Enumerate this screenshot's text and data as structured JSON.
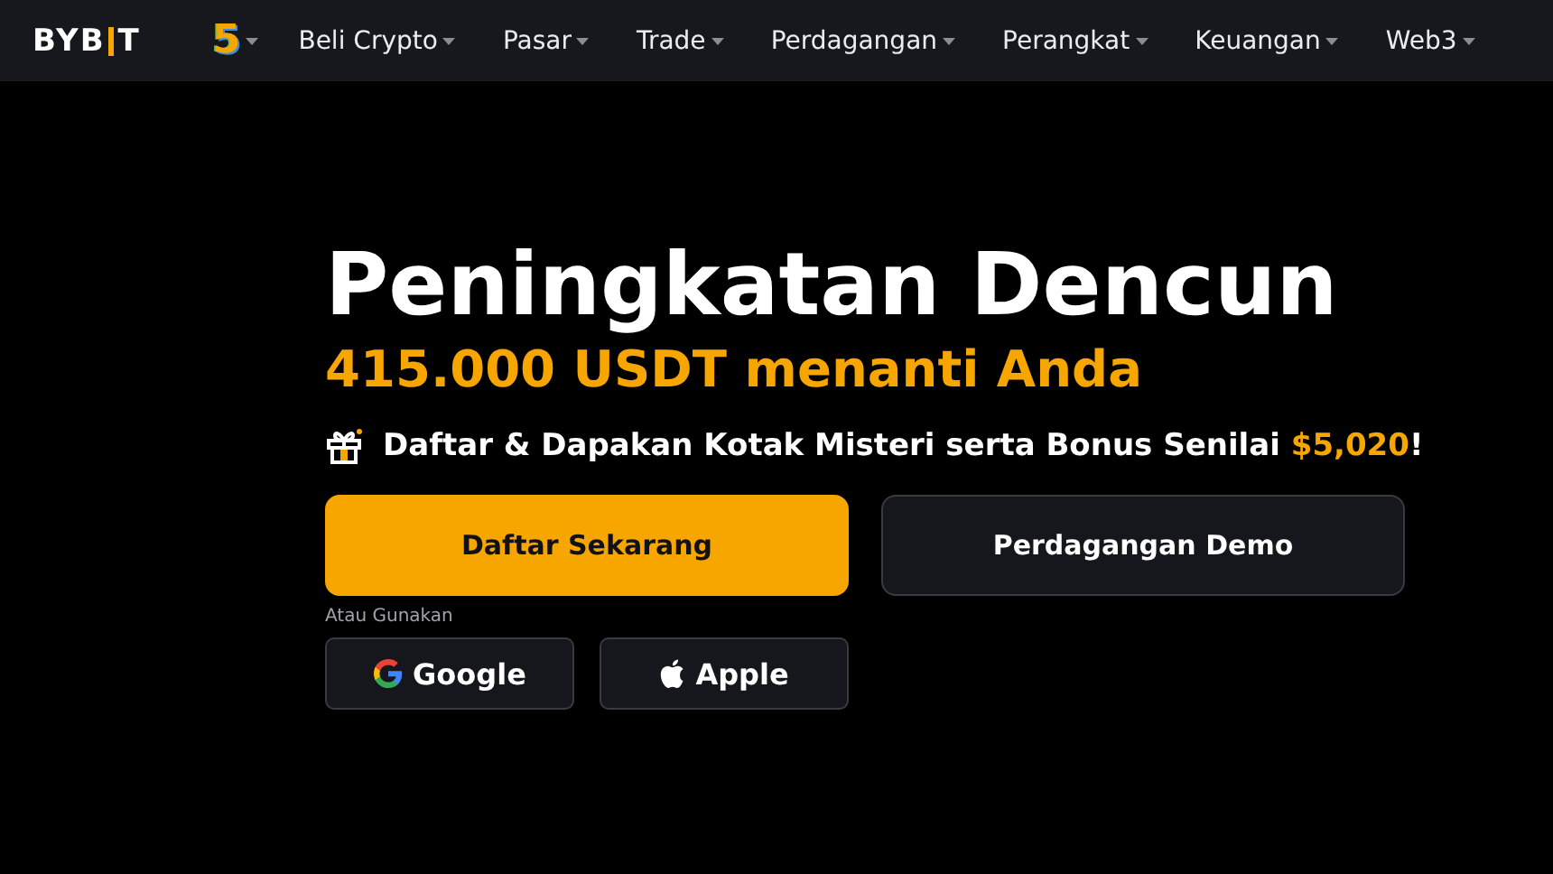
{
  "header": {
    "logo": {
      "left": "BYB",
      "right": "T"
    },
    "badge": "5",
    "nav": [
      {
        "label": "Beli Crypto"
      },
      {
        "label": "Pasar"
      },
      {
        "label": "Trade"
      },
      {
        "label": "Perdagangan"
      },
      {
        "label": "Perangkat"
      },
      {
        "label": "Keuangan"
      },
      {
        "label": "Web3"
      }
    ]
  },
  "hero": {
    "title": "Peningkatan Dencun",
    "subtitle": "415.000 USDT menanti Anda",
    "bonus": "Daftar & Dapakan Kotak Misteri serta Bonus Senilai ",
    "bonus_amount": "$5,020",
    "bonus_end": "!",
    "primary_button": "Daftar Sekarang",
    "secondary_button": "Perdagangan Demo",
    "alt_label": "Atau Gunakan",
    "social": [
      {
        "kind": "google",
        "label": "Google"
      },
      {
        "kind": "apple",
        "label": "Apple"
      }
    ]
  }
}
